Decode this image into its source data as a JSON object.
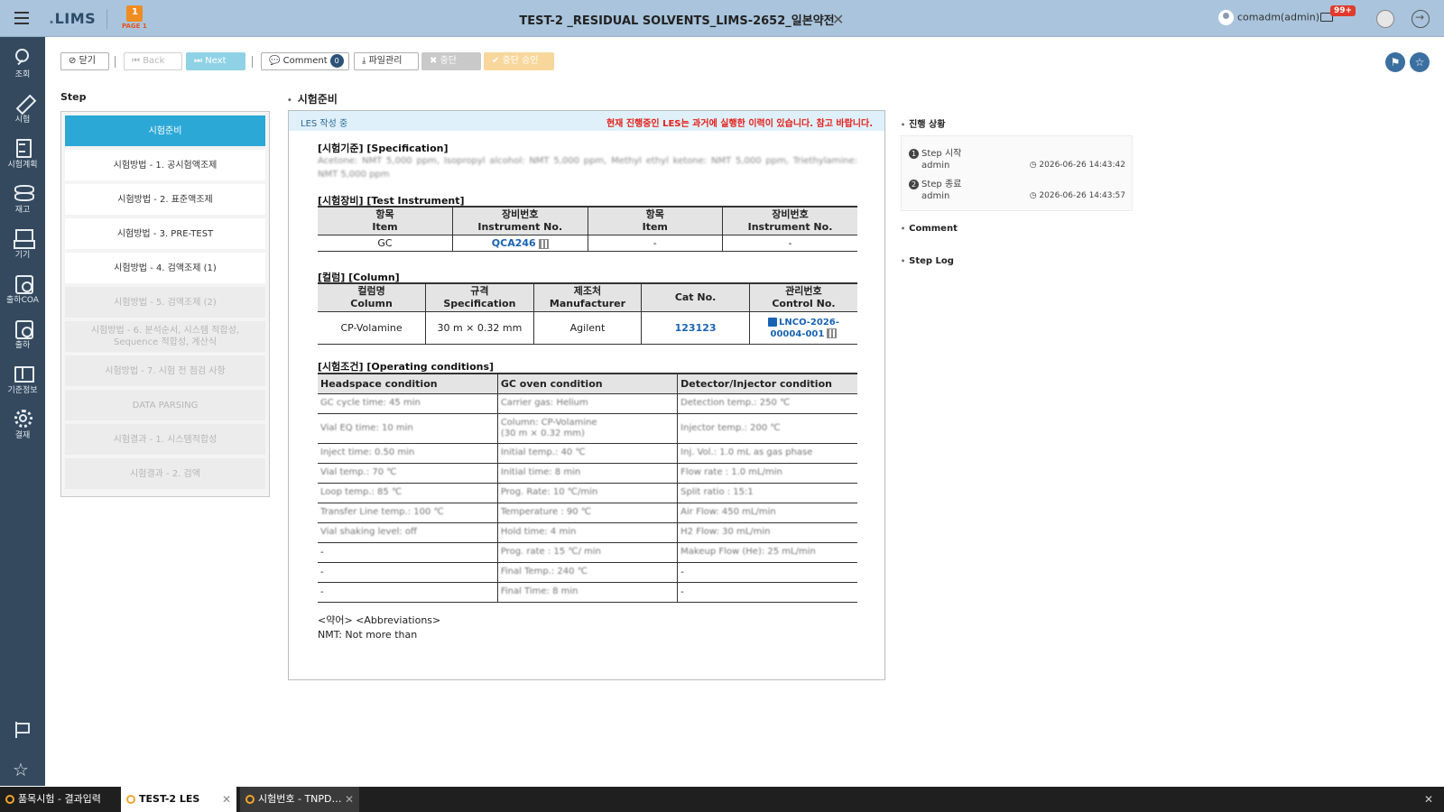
{
  "header": {
    "logo": "LIMS",
    "page_logo_number": "1",
    "page_logo_text": "PAGE 1",
    "title": "TEST-2 _RESIDUAL SOLVENTS_LIMS-2652_일본약전",
    "user": "comadm(admin)",
    "mail_count": "99+"
  },
  "sidebar": {
    "items": [
      {
        "label": "조회",
        "icon": "search-icon"
      },
      {
        "label": "시험",
        "icon": "pen-icon"
      },
      {
        "label": "시험계획",
        "icon": "document-icon"
      },
      {
        "label": "재고",
        "icon": "layers-icon"
      },
      {
        "label": "기기",
        "icon": "device-icon"
      },
      {
        "label": "출하COA",
        "icon": "coa-icon"
      },
      {
        "label": "출하",
        "icon": "shipping-icon"
      },
      {
        "label": "기준정보",
        "icon": "book-icon"
      },
      {
        "label": "결재",
        "icon": "gear-icon"
      }
    ]
  },
  "toolbar": {
    "close": "닫기",
    "back": "Back",
    "next": "Next",
    "comment": "Comment",
    "comment_count": "0",
    "file": "파일관리",
    "stop": "중단",
    "stop_approve": "중단 승인"
  },
  "steps": {
    "title": "Step",
    "items": [
      {
        "label": "시험준비"
      },
      {
        "label": "시험방법 - 1. 공시험액조제"
      },
      {
        "label": "시험방법 - 2. 표준액조제"
      },
      {
        "label": "시험방법 - 3. PRE-TEST"
      },
      {
        "label": "시험방법 - 4. 검액조제 (1)"
      },
      {
        "label": "시험방법 - 5. 검액조제 (2)"
      },
      {
        "label": "시험방법 - 6. 분석순서, 시스템 적합성, Sequence 적합성, 계산식"
      },
      {
        "label": "시험방법 - 7. 시험 전 점검 사항"
      },
      {
        "label": "DATA PARSING"
      },
      {
        "label": "시험결과 - 1. 시스템적합성"
      },
      {
        "label": "시험결과 - 2. 검액"
      }
    ]
  },
  "main": {
    "section_title": "시험준비",
    "status": "LES 작성 중",
    "warning": "현재 진행중인 LES는 과거에 실행한 이력이 있습니다. 참고 바랍니다.",
    "spec_label": "[시험기준] [Specification]",
    "spec_text": "Acetone: NMT 5,000 ppm, Isopropyl alcohol: NMT 5,000 ppm, Methyl ethyl ketone: NMT 5,000 ppm, Triethylamine: NMT 5,000 ppm",
    "instrument_label": "[시험장비] [Test Instrument]",
    "instrument_headers": [
      {
        "ko": "항목",
        "en": "Item"
      },
      {
        "ko": "장비번호",
        "en": "Instrument No."
      },
      {
        "ko": "항목",
        "en": "Item"
      },
      {
        "ko": "장비번호",
        "en": "Instrument No."
      }
    ],
    "instrument_row": [
      "GC",
      "QCA246",
      "-",
      "-"
    ],
    "column_label": "[컬럼] [Column]",
    "column_headers": [
      {
        "ko": "컬럼명",
        "en": "Column"
      },
      {
        "ko": "규격",
        "en": "Specification"
      },
      {
        "ko": "제조처",
        "en": "Manufacturer"
      },
      {
        "ko": "",
        "en": "Cat No."
      },
      {
        "ko": "관리번호",
        "en": "Control No."
      }
    ],
    "column_row": [
      "CP-Volamine",
      "30 m × 0.32 mm",
      "Agilent",
      "123123",
      "LNCO-2026-00004-001"
    ],
    "conditions_label": "[시험조건] [Operating conditions]",
    "conditions_headers": [
      "Headspace condition",
      "GC oven condition",
      "Detector/Injector condition"
    ],
    "conditions_rows": [
      [
        "GC cycle time: 45 min",
        "Carrier gas: Helium",
        "Detection temp.: 250 ℃"
      ],
      [
        "Vial EQ time: 10 min",
        "Column: CP-Volamine (30 m × 0.32 mm)",
        "Injector temp.: 200 ℃"
      ],
      [
        "Inject time: 0.50 min",
        "Initial temp.: 40 ℃",
        "Inj. Vol.: 1.0 mL as gas phase"
      ],
      [
        "Vial temp.: 70 ℃",
        "Initial time: 8 min",
        "Flow rate : 1.0 mL/min"
      ],
      [
        "Loop temp.: 85 ℃",
        "Prog. Rate: 10 ℃/min",
        "Split ratio : 15:1"
      ],
      [
        "Transfer Line temp.: 100 ℃",
        "Temperature : 90 ℃",
        "Air Flow: 450 mL/min"
      ],
      [
        "Vial shaking level: off",
        "Hold time: 4 min",
        "H2 Flow: 30 mL/min"
      ],
      [
        "-",
        "Prog. rate : 15 ℃/ min",
        "Makeup Flow (He): 25 mL/min"
      ],
      [
        "-",
        "Final Temp.: 240 ℃",
        "-"
      ],
      [
        "-",
        "Final Time: 8 min",
        "-"
      ]
    ],
    "abbr_title": "<약어> <Abbreviations>",
    "abbr_text": "NMT: Not more than"
  },
  "right_panel": {
    "progress_title": "진행 상황",
    "rows": [
      {
        "num": "1",
        "label": "Step 시작",
        "who": "admin",
        "time": "2026-06-26 14:43:42"
      },
      {
        "num": "2",
        "label": "Step 종료",
        "who": "admin",
        "time": "2026-06-26 14:43:57"
      }
    ],
    "comment_title": "Comment",
    "steplog_title": "Step Log"
  },
  "bottom_tabs": [
    {
      "label": "품목시험 - 결과입력"
    },
    {
      "label": "TEST-2 LES"
    },
    {
      "label": "시험번호 - TNPD…"
    }
  ]
}
